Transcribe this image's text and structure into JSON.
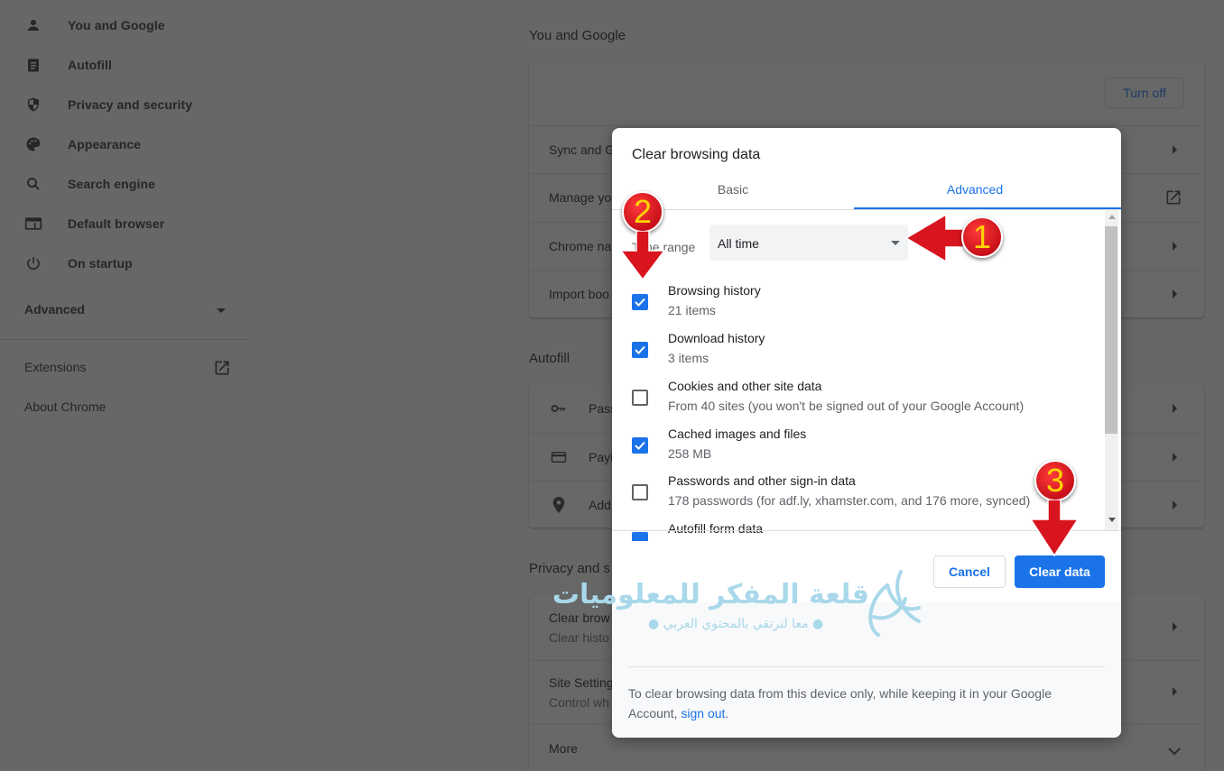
{
  "sidebar": {
    "items": [
      {
        "label": "You and Google",
        "icon": "person-icon"
      },
      {
        "label": "Autofill",
        "icon": "clipboard-icon"
      },
      {
        "label": "Privacy and security",
        "icon": "shield-icon"
      },
      {
        "label": "Appearance",
        "icon": "palette-icon"
      },
      {
        "label": "Search engine",
        "icon": "search-icon"
      },
      {
        "label": "Default browser",
        "icon": "browser-window-icon"
      },
      {
        "label": "On startup",
        "icon": "power-icon"
      }
    ],
    "advanced_label": "Advanced",
    "extensions_label": "Extensions",
    "about_label": "About Chrome"
  },
  "main": {
    "you_and_google": {
      "title": "You and Google",
      "turn_off_label": "Turn off",
      "rows": [
        "Sync and G",
        "Manage yo",
        "Chrome na",
        "Import boo"
      ]
    },
    "autofill": {
      "title": "Autofill",
      "rows": [
        {
          "label": "Pass",
          "icon": "key-icon"
        },
        {
          "label": "Payi",
          "icon": "credit-card-icon"
        },
        {
          "label": "Add",
          "icon": "location-pin-icon"
        }
      ]
    },
    "privacy": {
      "title": "Privacy and s",
      "rows": [
        {
          "title": "Clear brow",
          "subtitle": "Clear histo"
        },
        {
          "title": "Site Setting",
          "subtitle": "Control wh"
        },
        {
          "title": "More",
          "subtitle": ""
        }
      ]
    }
  },
  "dialog": {
    "title": "Clear browsing data",
    "tabs": [
      {
        "label": "Basic",
        "active": false
      },
      {
        "label": "Advanced",
        "active": true
      }
    ],
    "time_range_label": "Time range",
    "time_range_value": "All time",
    "options": [
      {
        "title": "Browsing history",
        "subtitle": "21 items",
        "checked": true
      },
      {
        "title": "Download history",
        "subtitle": "3 items",
        "checked": true
      },
      {
        "title": "Cookies and other site data",
        "subtitle": "From 40 sites (you won't be signed out of your Google Account)",
        "checked": false
      },
      {
        "title": "Cached images and files",
        "subtitle": "258 MB",
        "checked": true
      },
      {
        "title": "Passwords and other sign-in data",
        "subtitle": "178 passwords (for adf.ly, xhamster.com, and 176 more, synced)",
        "checked": false
      },
      {
        "title": "Autofill form data",
        "subtitle": "",
        "checked": true
      }
    ],
    "cancel_label": "Cancel",
    "clear_label": "Clear data",
    "info_text": "To clear browsing data from this device only, while keeping it in your Google Account, ",
    "sign_out_link": "sign out",
    "info_suffix": "."
  },
  "watermark": {
    "line1": "قلعة المفكر للمعلوميات",
    "line2": "● معا لنرتقي بالمحتوي العربي ●"
  },
  "annotations": {
    "step1": "1",
    "step2": "2",
    "step3": "3"
  },
  "colors": {
    "accent": "#1a73e8",
    "overlay": "#676767",
    "annotation_red": "#d8141e",
    "annotation_number": "#ffd400"
  }
}
